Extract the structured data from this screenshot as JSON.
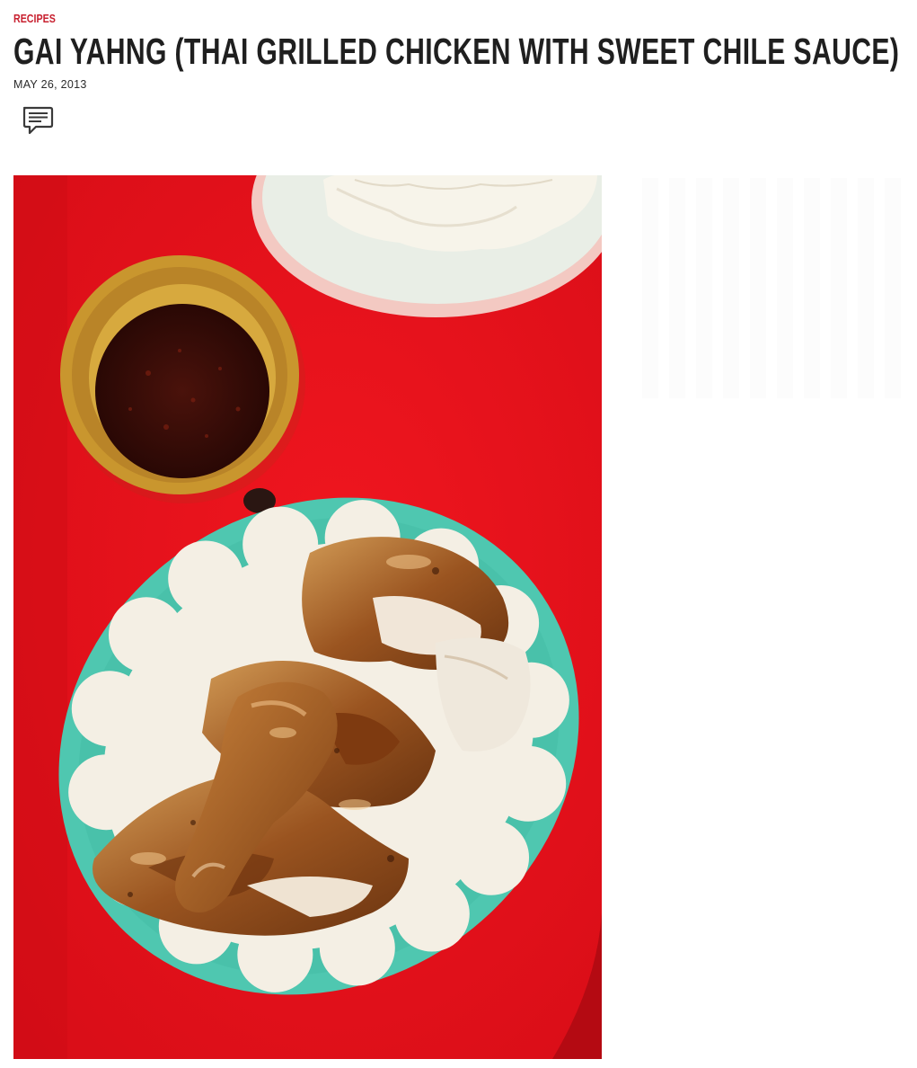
{
  "article": {
    "category": "RECIPES",
    "title": "GAI YAHNG (THAI GRILLED CHICKEN WITH SWEET CHILE SAUCE)",
    "date": "MAY 26, 2013"
  },
  "actions": {
    "comment_icon": "comment-speech-bubble-icon"
  },
  "hero_image": {
    "description_icon": "photo-grilled-chicken-rice-chile-sauce"
  },
  "colors": {
    "category_red": "#c8202f",
    "title_text": "#1f1f1f",
    "table_red": "#e8121d",
    "platter_teal": "#4fc7b0",
    "platter_cream": "#f4efe4",
    "sauce_bowl": "#c9962e",
    "sauce": "#3b0d08"
  }
}
